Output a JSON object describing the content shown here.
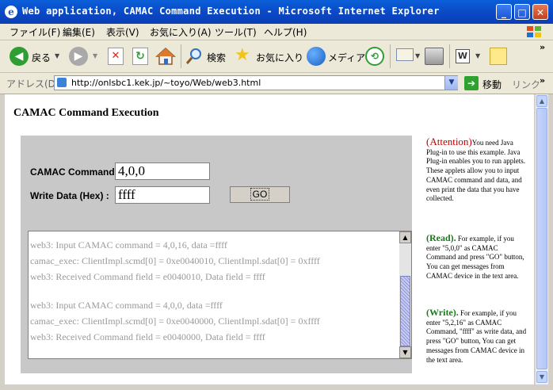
{
  "window": {
    "title": "Web application, CAMAC Command Execution - Microsoft Internet Explorer",
    "app_icon": "e",
    "buttons": {
      "minimize": "_",
      "maximize": "□",
      "close": "✕"
    }
  },
  "menu": [
    "ファイル(F)",
    "編集(E)",
    "表示(V)",
    "お気に入り(A)",
    "ツール(T)",
    "ヘルプ(H)"
  ],
  "toolbar": {
    "back": "戻る",
    "search": "検索",
    "favorites": "お気に入り",
    "media": "メディア",
    "more": "»"
  },
  "address": {
    "label": "アドレス(D)",
    "url": "http://onlsbc1.kek.jp/~toyo/Web/web3.html",
    "go": "移動",
    "links": "リンク",
    "links_more": "»"
  },
  "page": {
    "title": "CAMAC Command Execution",
    "form": {
      "command_label": "CAMAC Command:",
      "command_value": "4,0,0",
      "data_label": "Write Data (Hex)  :",
      "data_value": "ffff",
      "go_label": "GO"
    },
    "output_lines": [
      "web3:  Input CAMAC command = 4,0,16,    data =ffff",
      "camac_exec: ClientImpl.scmd[0] = 0xe0040010, ClientImpl.sdat[0] = 0xffff",
      "web3:  Received Command field = e0040010,    Data field = ffff",
      "",
      "web3:  Input CAMAC command = 4,0,0,    data =ffff",
      "camac_exec: ClientImpl.scmd[0] = 0xe0040000, ClientImpl.sdat[0] = 0xffff",
      "web3:  Received Command field = e0040000,    Data field = ffff"
    ],
    "sidebar": {
      "attention_head": "(Attention)",
      "attention_text": "You need Java Plug-in to use this example. Java Plug-in enables you to run applets. These applets allow you to input CAMAC command and data, and even print the data that you have collected.",
      "read_head": "(Read).",
      "read_text": " For example, if you enter \"5,0,0\" as CAMAC Command and press \"GO\" button, You can get messages from CAMAC device in the text area.",
      "write_head": "(Write).",
      "write_text": " For example, if you enter \"5,2,16\" as CAMAC Command, \"ffff\" as write data, and press \"GO\" button, You can get messages from CAMAC device in the text area."
    }
  }
}
